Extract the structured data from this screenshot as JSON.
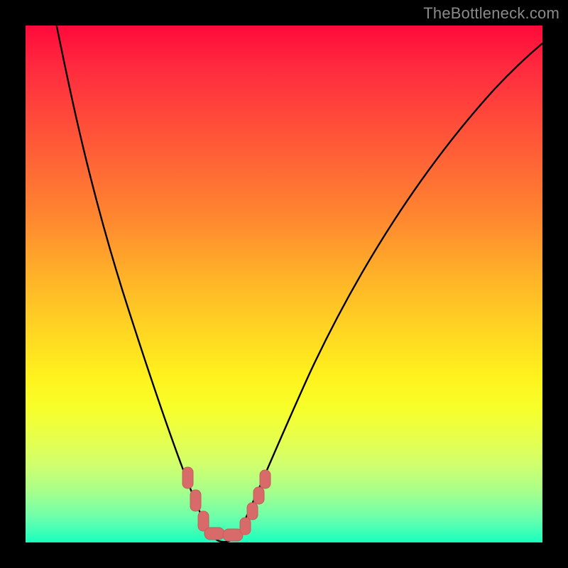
{
  "watermark": {
    "text": "TheBottleneck.com"
  },
  "colors": {
    "curve": "#000000",
    "marker_fill": "#d86a6a",
    "marker_stroke": "#c65c5c",
    "background_frame": "#000000"
  },
  "chart_data": {
    "type": "line",
    "title": "",
    "xlabel": "",
    "ylabel": "",
    "xlim": [
      0,
      100
    ],
    "ylim": [
      0,
      100
    ],
    "grid": false,
    "legend": false,
    "description": "V-shaped bottleneck curve over rainbow heatmap background (red = high bottleneck at top, green = low at bottom). Minimum region is around x ≈ 34–40, y ≈ 0.",
    "series": [
      {
        "name": "bottleneck-curve",
        "x": [
          6,
          10,
          14,
          18,
          22,
          26,
          30,
          33,
          35,
          37,
          39,
          41,
          44,
          50,
          58,
          68,
          80,
          92,
          100
        ],
        "values": [
          100,
          85,
          70,
          56,
          43,
          31,
          20,
          10,
          3,
          0,
          0,
          3,
          10,
          22,
          38,
          55,
          72,
          88,
          96
        ]
      }
    ],
    "markers": {
      "name": "highlighted-points",
      "shape": "rounded-pill",
      "color": "#d86a6a",
      "points_xy": [
        [
          30,
          12
        ],
        [
          32,
          7
        ],
        [
          34,
          2
        ],
        [
          36,
          0
        ],
        [
          38,
          0
        ],
        [
          40,
          2
        ],
        [
          42,
          5
        ],
        [
          43,
          8
        ],
        [
          44,
          11
        ]
      ]
    }
  }
}
